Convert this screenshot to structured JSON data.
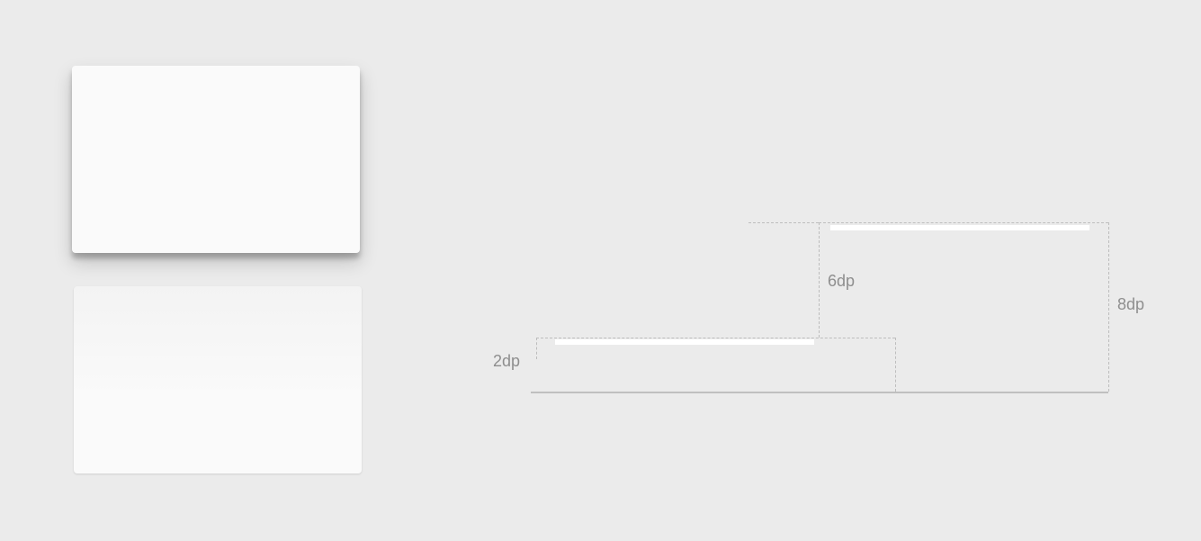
{
  "cards": {
    "top": {
      "elevation_label": ""
    },
    "bottom": {
      "elevation_label": ""
    }
  },
  "diagram": {
    "labels": {
      "small": "2dp",
      "medium": "6dp",
      "large": "8dp"
    }
  }
}
